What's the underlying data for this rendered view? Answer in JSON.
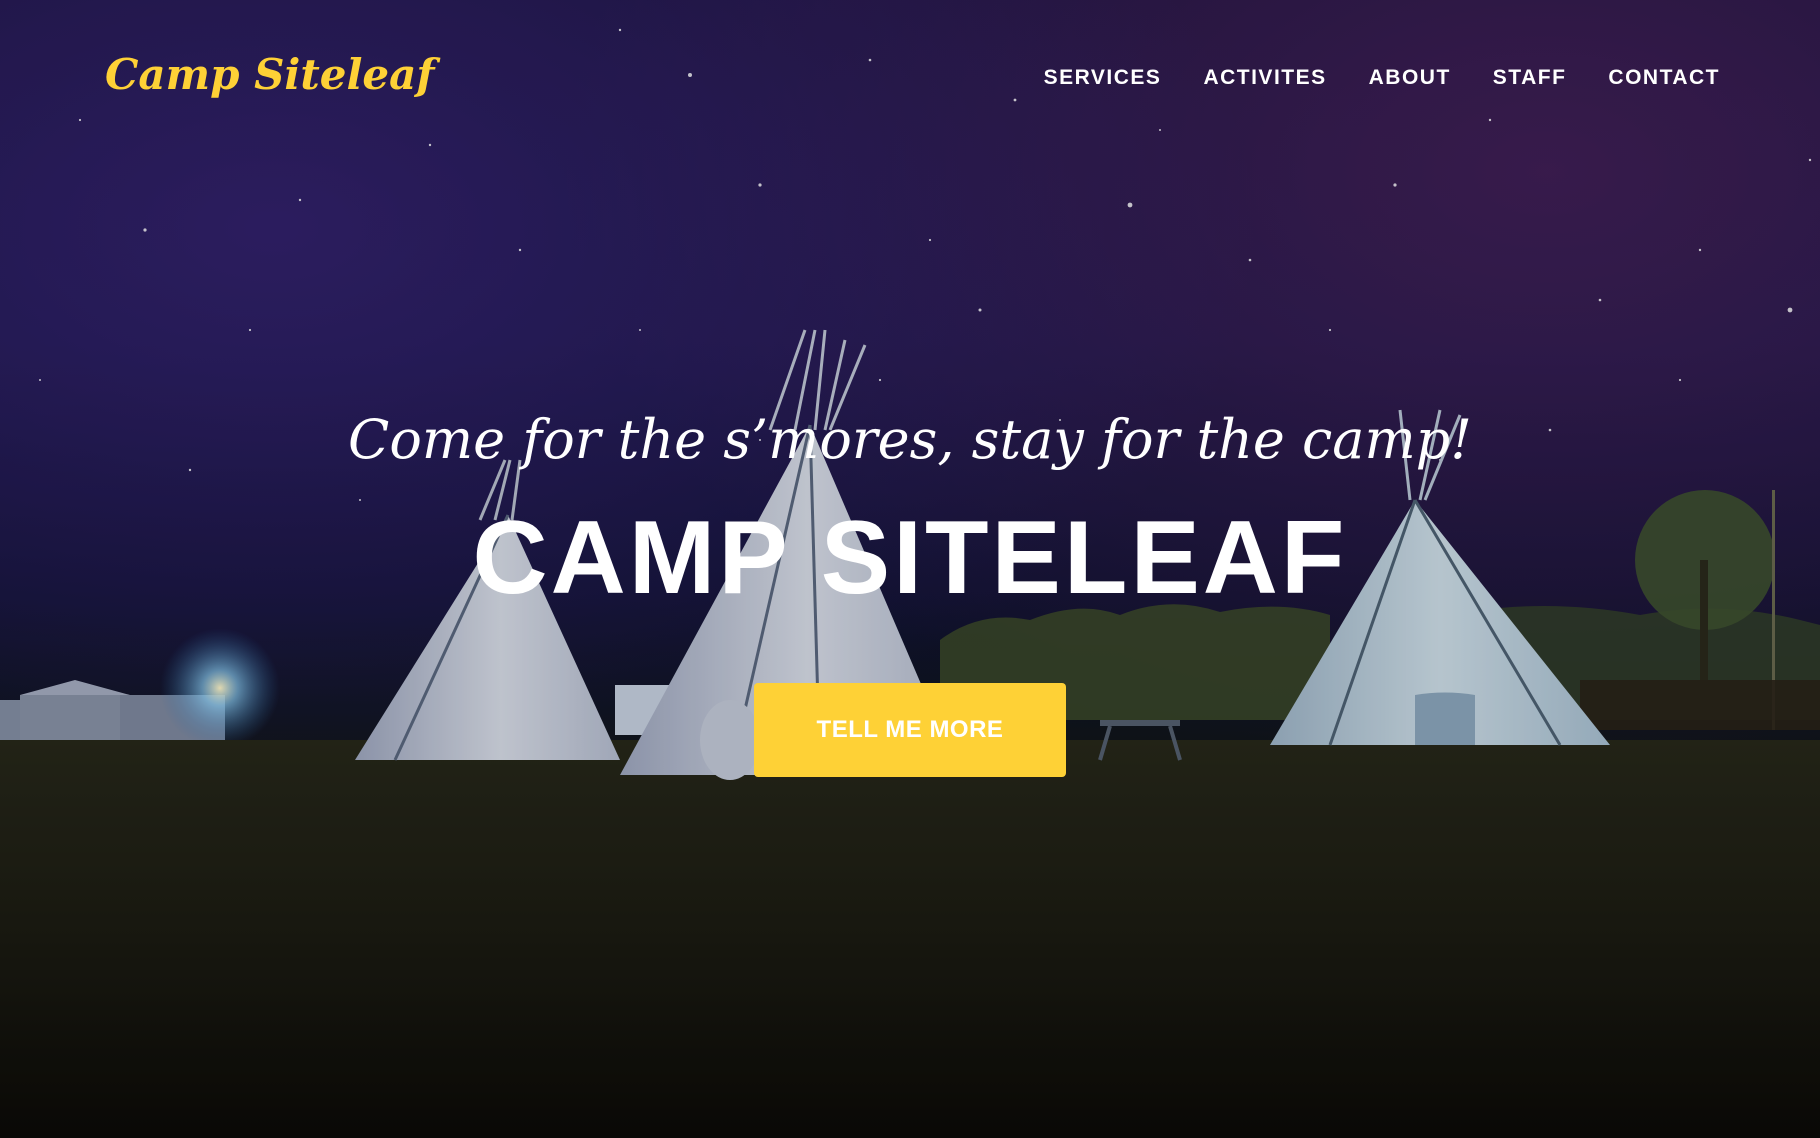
{
  "brand": {
    "name": "Camp Siteleaf",
    "color": "#fed136"
  },
  "nav": {
    "items": [
      {
        "label": "SERVICES"
      },
      {
        "label": "ACTIVITES"
      },
      {
        "label": "ABOUT"
      },
      {
        "label": "STAFF"
      },
      {
        "label": "CONTACT"
      }
    ]
  },
  "hero": {
    "lead": "Come for the s’mores, stay for the camp!",
    "heading": "CAMP SITELEAF",
    "cta_label": "TELL ME MORE",
    "accent_color": "#fed136",
    "background_image": "night-sky-teepee-campsite-photo"
  }
}
